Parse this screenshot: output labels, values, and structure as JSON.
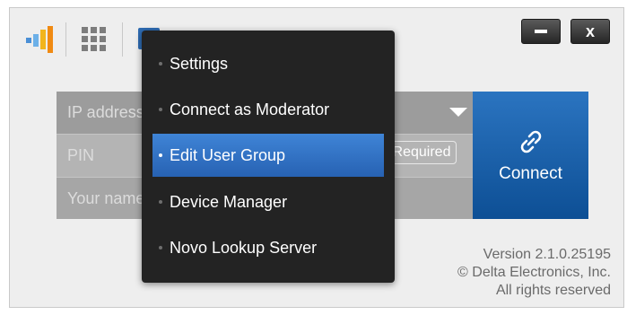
{
  "toolbar": {
    "icons": [
      "connection-signal-icon",
      "grid-icon",
      "menu-icon"
    ],
    "minimize_icon": "minimize-icon",
    "close_icon": "close-icon",
    "close_label": "x"
  },
  "form": {
    "ip_placeholder": "IP address",
    "pin_placeholder": "PIN",
    "pin_badge": "Required",
    "name_placeholder": "Your name"
  },
  "connect": {
    "label": "Connect",
    "icon": "link-icon"
  },
  "menu": {
    "items": [
      {
        "label": "Settings",
        "active": false
      },
      {
        "label": "Connect as Moderator",
        "active": false
      },
      {
        "label": "Edit User Group",
        "active": true
      },
      {
        "label": "Device Manager",
        "active": false
      },
      {
        "label": "Novo Lookup Server",
        "active": false
      }
    ]
  },
  "version": {
    "line1": "Version 2.1.0.25195",
    "line2": "© Delta Electronics, Inc.",
    "line3": "All rights reserved"
  },
  "colors": {
    "accent": "#2e6cb3",
    "menu_bg": "#232323",
    "connect_bg": "#1a5fa6"
  }
}
